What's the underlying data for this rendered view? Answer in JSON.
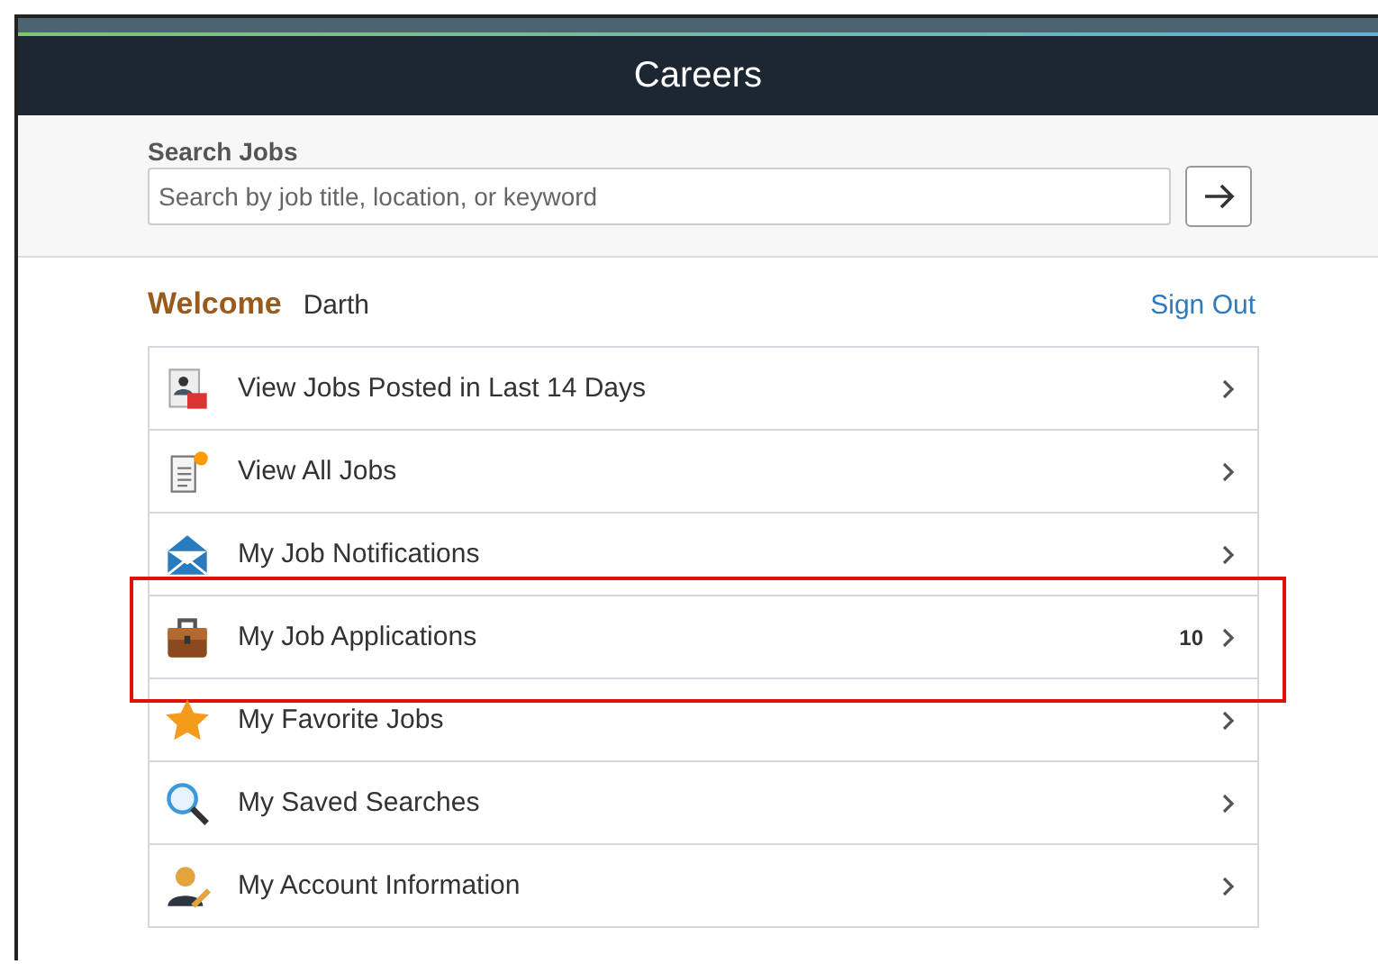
{
  "header": {
    "title": "Careers"
  },
  "search": {
    "label": "Search Jobs",
    "placeholder": "Search by job title, location, or keyword"
  },
  "welcome": {
    "label": "Welcome",
    "name": "Darth",
    "sign_out": "Sign Out"
  },
  "menu": [
    {
      "kind": "posted",
      "label": "View Jobs Posted in Last 14 Days",
      "highlighted": false
    },
    {
      "kind": "all",
      "label": "View All Jobs",
      "highlighted": false
    },
    {
      "kind": "notification",
      "label": "My Job Notifications",
      "highlighted": false
    },
    {
      "kind": "application",
      "label": "My Job Applications",
      "count": "10",
      "highlighted": true
    },
    {
      "kind": "favorite",
      "label": "My Favorite Jobs",
      "highlighted": false
    },
    {
      "kind": "search",
      "label": "My Saved Searches",
      "highlighted": false
    },
    {
      "kind": "account",
      "label": "My Account Information",
      "highlighted": false
    }
  ]
}
